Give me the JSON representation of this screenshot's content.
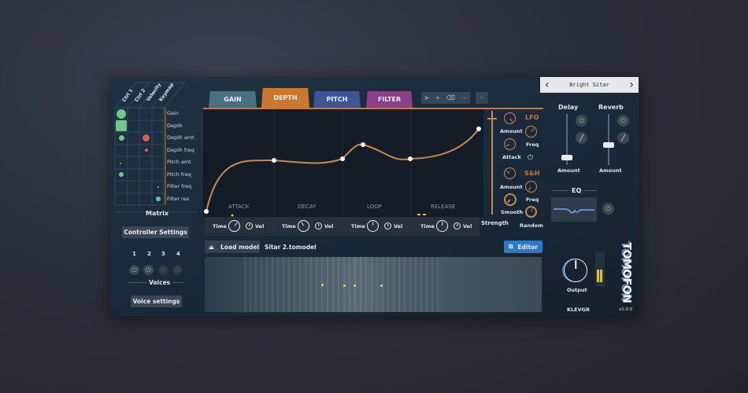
{
  "matrix": {
    "title": "Matrix",
    "columns": [
      "Ctrl 1",
      "Ctrl 2",
      "Velocity",
      "Keymap"
    ],
    "rows": [
      "Gain",
      "Depth",
      "Depth amt",
      "Depth freq",
      "Pitch amt",
      "Pitch freq",
      "Filter freq",
      "Filter res"
    ]
  },
  "controller_settings": "Controller Settings",
  "voices": {
    "label": "Voices",
    "numbers": [
      "1",
      "2",
      "3",
      "4"
    ],
    "settings": "Voice settings"
  },
  "tabs": [
    {
      "label": "GAIN",
      "color": "#4a6f82"
    },
    {
      "label": "DEPTH",
      "color": "#c9782e"
    },
    {
      "label": "PITCH",
      "color": "#3d5590"
    },
    {
      "label": "FILTER",
      "color": "#8a3f86"
    }
  ],
  "active_tab": "DEPTH",
  "envelope": {
    "stages": [
      "ATTACK",
      "DECAY",
      "LOOP",
      "RELEASE"
    ],
    "time": "Time",
    "vel": "Vel"
  },
  "mod": {
    "lfo": "LFO",
    "amount": "Amount",
    "freq": "Freq",
    "attack": "Attack",
    "sh": "S&H",
    "amount2": "Amount",
    "freq2": "Freq",
    "smooth": "Smooth",
    "random": "Random",
    "strength": "Strength"
  },
  "load_model": "Load model",
  "model_name": "Sitar 2.tomodel",
  "editor": "Editor",
  "preset": {
    "name": "Bright Sitar",
    "prev": "‹",
    "next": "›"
  },
  "fx": {
    "delay": "Delay",
    "reverb": "Reverb",
    "amount": "Amount",
    "eq": "EQ",
    "output": "Output"
  },
  "brand": {
    "logo": "TOMOFON",
    "company": "KLEVGR",
    "version": "v1.0.0"
  },
  "colors": {
    "accent_orange": "#c9782e",
    "power_green": "#7fd39b",
    "editor_blue": "#2f78c4"
  }
}
